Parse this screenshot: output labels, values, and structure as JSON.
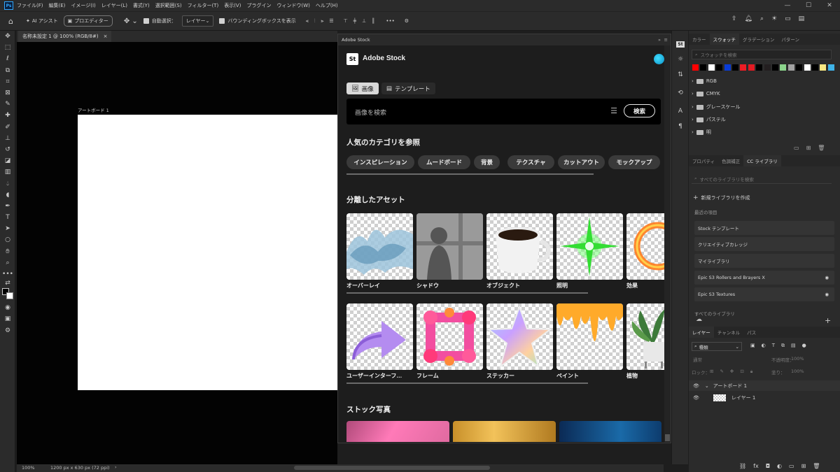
{
  "app": {
    "logo": "Ps",
    "menu": [
      "ファイル(F)",
      "編集(E)",
      "イメージ(I)",
      "レイヤー(L)",
      "書式(Y)",
      "選択範囲(S)",
      "フィルター(T)",
      "表示(V)",
      "プラグイン",
      "ウィンドウ(W)",
      "ヘルプ(H)"
    ]
  },
  "options": {
    "ai_assist": "AI アシスト",
    "pro_editor": "プロエディター",
    "auto_select": "自動選択：",
    "auto_select_target": "レイヤー",
    "show_bbox": "バウンディングボックスを表示"
  },
  "document": {
    "tab_title": "名称未設定 1 @ 100% (RGB/8#)",
    "artboard_label": "アートボード 1",
    "zoom": "100%",
    "doc_size": "1200 px x 630 px (72 ppi)"
  },
  "stock": {
    "panel_title": "Adobe Stock",
    "logo": "St",
    "header": "Adobe Stock",
    "tabs": {
      "images": "画像",
      "templates": "テンプレート"
    },
    "search_placeholder": "画像を検索",
    "search_button": "検索",
    "categories_title": "人気のカテゴリを参照",
    "categories": [
      "インスピレーション",
      "ムードボード",
      "背景",
      "テクスチャ",
      "カットアウト",
      "モックアップ"
    ],
    "assets_title": "分離したアセット",
    "assets_row1": [
      "オーバーレイ",
      "シャドウ",
      "オブジェクト",
      "照明",
      "効果"
    ],
    "assets_row2": [
      "ユーザーインターフ…",
      "フレーム",
      "ステッカー",
      "ペイント",
      "植物"
    ],
    "photos_title": "ストック写真"
  },
  "swatches": {
    "tabs": [
      "カラー",
      "スウォッチ",
      "グラデーション",
      "パターン"
    ],
    "search_placeholder": "スウォッチを検索",
    "colors": [
      "#ff0000",
      "#000000",
      "#ffffff",
      "#000000",
      "#0a3cd6",
      "#000000",
      "#ed1c24",
      "#e21b23",
      "#000000",
      "#231f20",
      "#000000",
      "#8bd38b",
      "#a1a1a1",
      "#000000",
      "#ffffff",
      "#000000",
      "#f6e681",
      "#3fb3e8"
    ],
    "folders": [
      "RGB",
      "CMYK",
      "グレースケール",
      "パステル",
      "明"
    ]
  },
  "libraries": {
    "tabs": [
      "プロパティ",
      "色調補正",
      "CC ライブラリ"
    ],
    "search_placeholder": "すべてのライブラリを検索",
    "create": "新規ライブラリを作成",
    "recent": "最近の項目",
    "items": [
      "Stock テンプレート",
      "クリエイティブカレッジ",
      "マイライブラリ",
      "Epic S3 Rollers and Brayers X",
      "Epic S3 Textures"
    ],
    "all": "すべてのライブラリ"
  },
  "layers": {
    "tabs": [
      "レイヤー",
      "チャンネル",
      "パス"
    ],
    "kind": "種類",
    "blend": "通常",
    "opacity_label": "不透明度：",
    "opacity": "100%",
    "lock_label": "ロック：",
    "fill_label": "塗り：",
    "fill": "100%",
    "artboard": "アートボード 1",
    "layer": "レイヤー 1"
  }
}
